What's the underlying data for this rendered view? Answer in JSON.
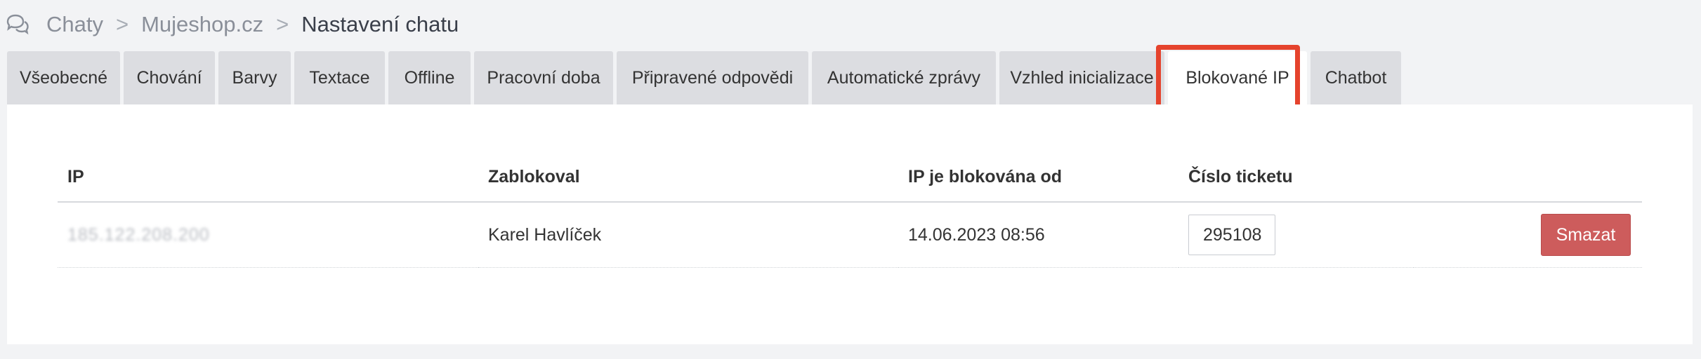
{
  "breadcrumb": {
    "icon": "chat-bubbles-icon",
    "items": [
      "Chaty",
      "Mujeshop.cz",
      "Nastavení chatu"
    ],
    "separator": ">"
  },
  "tabs": [
    {
      "label": "Všeobecné"
    },
    {
      "label": "Chování"
    },
    {
      "label": "Barvy"
    },
    {
      "label": "Textace"
    },
    {
      "label": "Offline"
    },
    {
      "label": "Pracovní doba"
    },
    {
      "label": "Připravené odpovědi"
    },
    {
      "label": "Automatické zprávy"
    },
    {
      "label": "Vzhled inicializace"
    },
    {
      "label": "Blokované IP"
    },
    {
      "label": "Chatbot"
    }
  ],
  "active_tab": "Blokované IP",
  "highlight_color": "#e5432d",
  "table": {
    "headers": {
      "ip": "IP",
      "blocked_by": "Zablokoval",
      "blocked_since": "IP je blokována od",
      "ticket": "Číslo ticketu"
    },
    "rows": [
      {
        "ip": "185.122.208.200",
        "blocked_by": "Karel Havlíček",
        "blocked_since": "14.06.2023 08:56",
        "ticket": "295108",
        "delete_label": "Smazat"
      }
    ]
  },
  "colors": {
    "delete_button": "#cd5c5c",
    "tab_inactive": "#dcdde1",
    "page_bg": "#f2f3f5"
  }
}
